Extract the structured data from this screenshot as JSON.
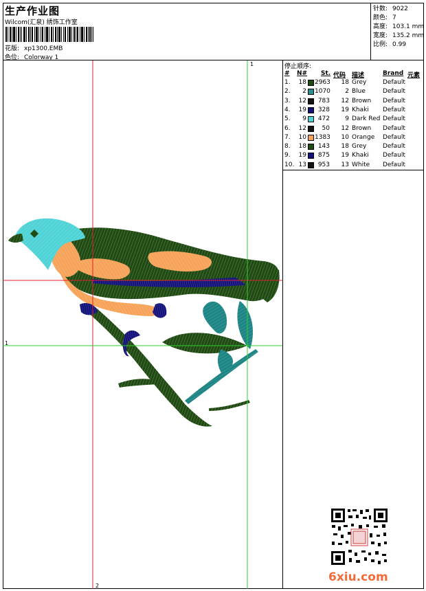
{
  "header": {
    "title": "生产作业图",
    "subtitle": "Wilcom(汇泉) 绣饰工作室",
    "design_label": "花版:",
    "design_value": "xp1300.EMB",
    "colorway_label": "色位:",
    "colorway_value": "Colorway 1"
  },
  "stats": [
    {
      "label": "针数:",
      "value": "9022"
    },
    {
      "label": "颜色:",
      "value": "7"
    },
    {
      "label": "高度:",
      "value": "103.1 mm"
    },
    {
      "label": "宽度:",
      "value": "135.2 mm"
    },
    {
      "label": "比例:",
      "value": "0.99"
    }
  ],
  "stop_sequence": {
    "title": "停止顺序:",
    "columns": [
      "#",
      "N#",
      "St.",
      "代码",
      "描述",
      "Brand",
      "元素"
    ],
    "rows": [
      {
        "idx": "1.",
        "n": "18",
        "color": "#1f4a12",
        "st": "2963",
        "code": "18",
        "desc": "Grey",
        "brand": "Default"
      },
      {
        "idx": "2.",
        "n": "2",
        "color": "#2a8e8e",
        "st": "1070",
        "code": "2",
        "desc": "Blue",
        "brand": "Default"
      },
      {
        "idx": "3.",
        "n": "12",
        "color": "#141414",
        "st": "783",
        "code": "12",
        "desc": "Brown",
        "brand": "Default"
      },
      {
        "idx": "4.",
        "n": "19",
        "color": "#12127a",
        "st": "328",
        "code": "19",
        "desc": "Khaki",
        "brand": "Default"
      },
      {
        "idx": "5.",
        "n": "9",
        "color": "#4fd3d6",
        "st": "472",
        "code": "9",
        "desc": "Dark Red",
        "brand": "Default"
      },
      {
        "idx": "6.",
        "n": "12",
        "color": "#141414",
        "st": "50",
        "code": "12",
        "desc": "Brown",
        "brand": "Default"
      },
      {
        "idx": "7.",
        "n": "10",
        "color": "#f7a35a",
        "st": "1383",
        "code": "10",
        "desc": "Orange",
        "brand": "Default"
      },
      {
        "idx": "8.",
        "n": "18",
        "color": "#1f4a12",
        "st": "143",
        "code": "18",
        "desc": "Grey",
        "brand": "Default"
      },
      {
        "idx": "9.",
        "n": "19",
        "color": "#12127a",
        "st": "875",
        "code": "19",
        "desc": "Khaki",
        "brand": "Default"
      },
      {
        "idx": "10.",
        "n": "13",
        "color": "#141414",
        "st": "953",
        "code": "13",
        "desc": "White",
        "brand": "Default"
      }
    ]
  },
  "guides": {
    "marker_v_green": "1",
    "marker_h_green": "1",
    "marker_v_red": "2"
  },
  "colors": {
    "guide_red": "#e0202a",
    "guide_green": "#2bd12b",
    "bird_head": "#4fd3d6",
    "bird_body": "#1f4a12",
    "bird_orange": "#f7a35a",
    "bird_navy": "#12127a",
    "leaf_teal": "#1e8585"
  },
  "watermark": {
    "brand_text": "6xiu.com"
  }
}
